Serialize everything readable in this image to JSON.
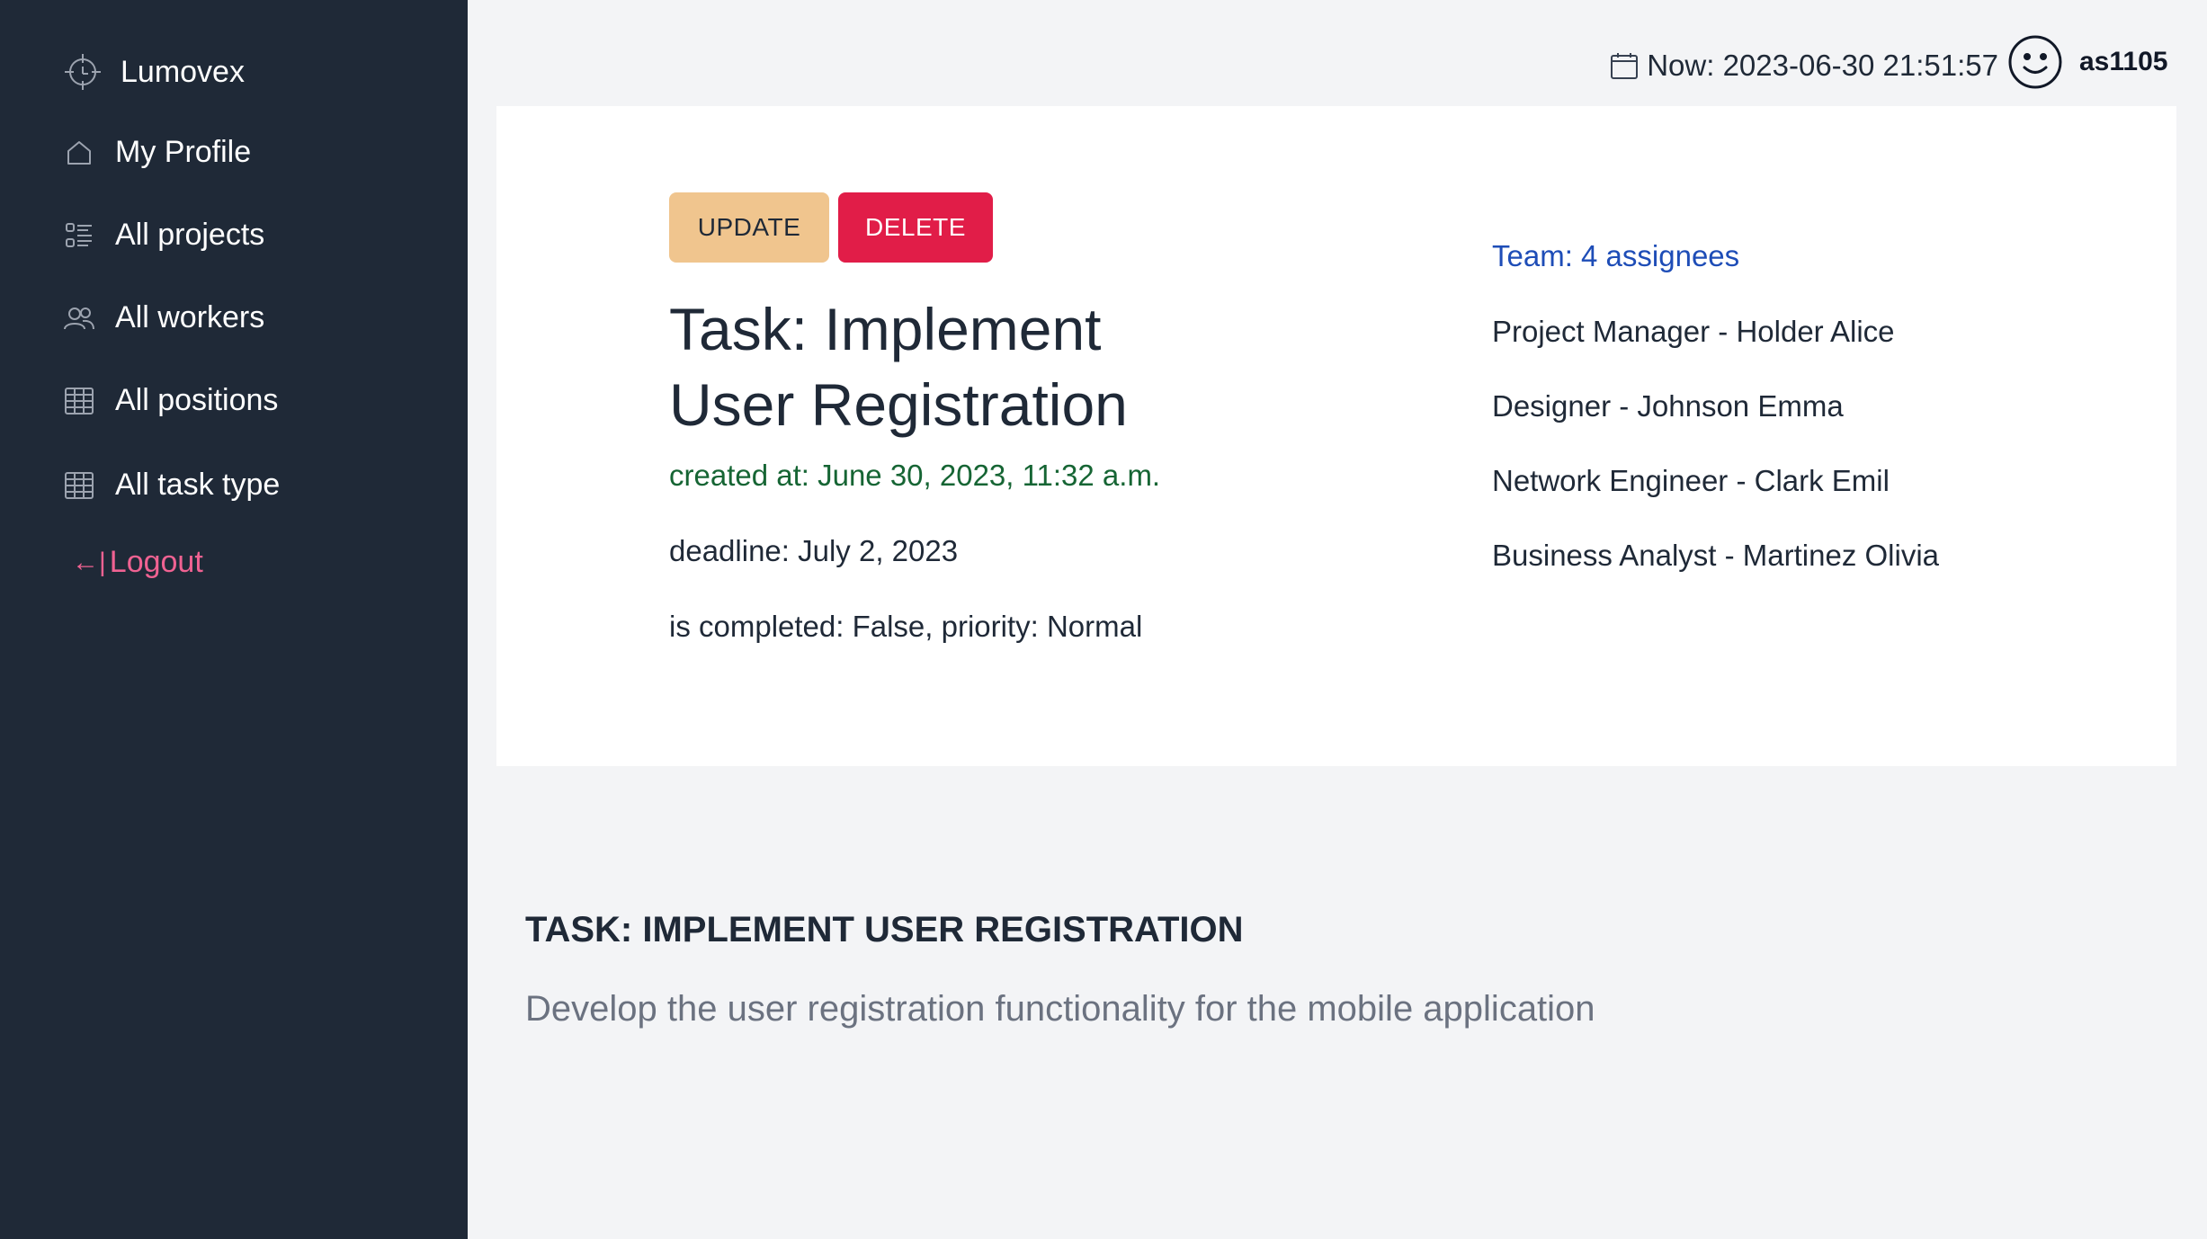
{
  "sidebar": {
    "brand": "Lumovex",
    "items": [
      {
        "label": "My Profile",
        "icon": "home-icon"
      },
      {
        "label": "All projects",
        "icon": "checklist-icon"
      },
      {
        "label": "All workers",
        "icon": "users-icon"
      },
      {
        "label": "All positions",
        "icon": "table-icon"
      },
      {
        "label": "All task type",
        "icon": "table-icon"
      }
    ],
    "logout": "Logout",
    "logout_arrow": "←|"
  },
  "topbar": {
    "now": "Now: 2023-06-30 21:51:57",
    "username": "as1105"
  },
  "task": {
    "update_label": "UPDATE",
    "delete_label": "DELETE",
    "title": "Task: Implement User Registration",
    "created": "created at: June 30, 2023, 11:32 a.m.",
    "deadline": "deadline: July 2, 2023",
    "status": "is completed: False, priority: Normal",
    "team_link": "Team: 4 assignees",
    "assignees": [
      "Project Manager - Holder Alice",
      "Designer - Johnson Emma",
      "Network Engineer - Clark Emil",
      "Business Analyst - Martinez Olivia"
    ]
  },
  "description": {
    "title": "TASK: IMPLEMENT USER REGISTRATION",
    "body": "Develop the user registration functionality for the mobile application"
  },
  "colors": {
    "sidebar_bg": "#1f2937",
    "update_button": "#f0c58e",
    "delete_button": "#e11d48",
    "created_text": "#166534",
    "team_link": "#1e4db7",
    "logout_text": "#f06292"
  }
}
